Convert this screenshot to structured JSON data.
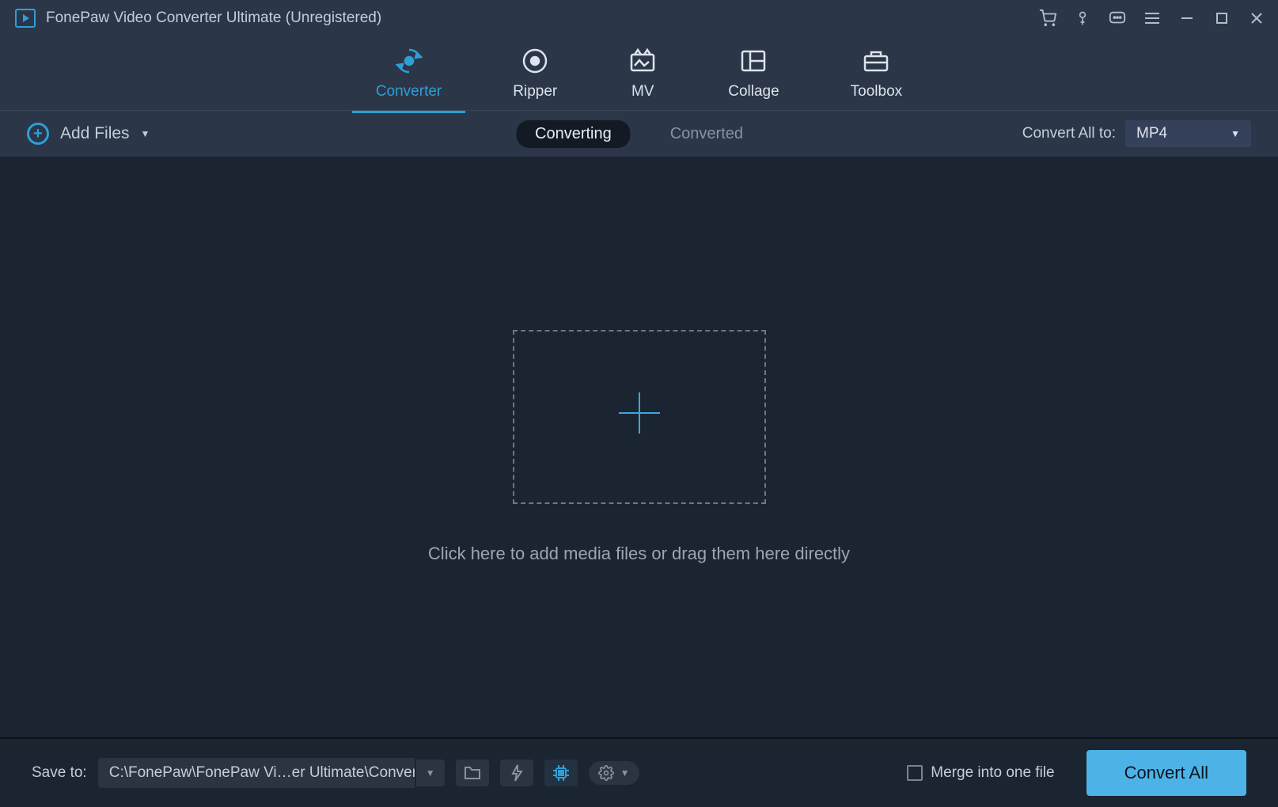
{
  "app": {
    "title": "FonePaw Video Converter Ultimate (Unregistered)"
  },
  "tabs": {
    "converter": "Converter",
    "ripper": "Ripper",
    "mv": "MV",
    "collage": "Collage",
    "toolbox": "Toolbox"
  },
  "toolbar": {
    "add_files": "Add Files",
    "converting": "Converting",
    "converted": "Converted",
    "convert_all_to": "Convert All to:",
    "format": "MP4"
  },
  "content": {
    "drop_text": "Click here to add media files or drag them here directly"
  },
  "bottom": {
    "save_to_label": "Save to:",
    "save_path": "C:\\FonePaw\\FonePaw Vi…er Ultimate\\Converted",
    "merge_label": "Merge into one file",
    "convert_all": "Convert All",
    "hw_accel": "ON"
  }
}
